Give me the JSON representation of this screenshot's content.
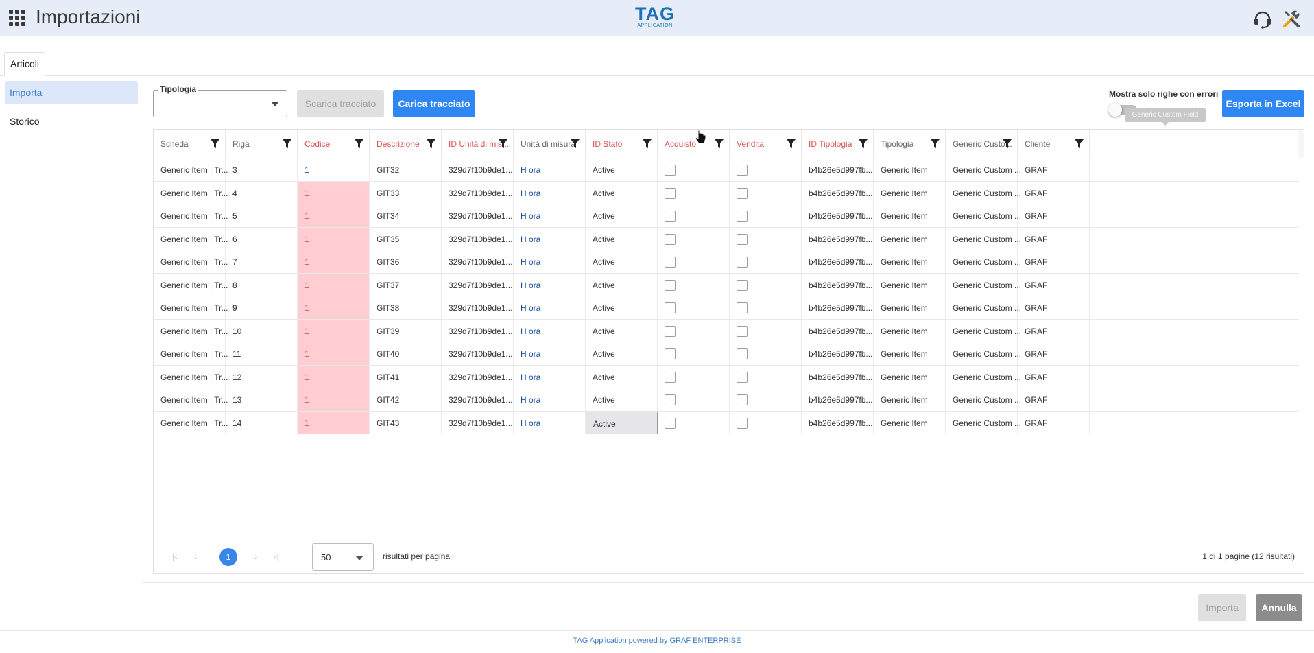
{
  "header": {
    "title": "Importazioni",
    "logo_main": "TAG",
    "logo_sub": "APPLICATION",
    "icons": [
      "apps-grid-icon",
      "headset-icon",
      "tools-icon"
    ]
  },
  "tabs": [
    {
      "label": "Articoli"
    }
  ],
  "sidebar": {
    "items": [
      {
        "label": "Importa",
        "active": true
      },
      {
        "label": "Storico",
        "active": false
      }
    ]
  },
  "toolbar": {
    "tipologia_label": "Tipologia",
    "tipologia_value": "",
    "download_label": "Scarica tracciato",
    "upload_label": "Carica tracciato",
    "errors_toggle_label": "Mostra solo righe con errori",
    "errors_toggle_on": false,
    "export_label": "Esporta in Excel",
    "tooltip": "Generic Custom Field"
  },
  "grid": {
    "columns": [
      {
        "label": "Scheda",
        "error": false
      },
      {
        "label": "Riga",
        "error": false
      },
      {
        "label": "Codice",
        "error": true
      },
      {
        "label": "Descrizione",
        "error": true
      },
      {
        "label": "ID Unità di mis...",
        "error": true
      },
      {
        "label": "Unità di misura",
        "error": false
      },
      {
        "label": "ID Stato",
        "error": true
      },
      {
        "label": "Acquisto",
        "error": true
      },
      {
        "label": "Vendita",
        "error": true
      },
      {
        "label": "ID Tipologia",
        "error": true
      },
      {
        "label": "Tipologia",
        "error": false
      },
      {
        "label": "Generic Custo...",
        "error": false
      },
      {
        "label": "Cliente",
        "error": false
      }
    ],
    "rows": [
      {
        "scheda": "Generic Item | Tr...",
        "riga": "3",
        "codice": "1",
        "codice_error": false,
        "descrizione": "GIT32",
        "id_um": "329d7f10b9de1...",
        "um": "H ora",
        "stato": "Active",
        "acquisto": false,
        "vendita": false,
        "id_tipologia": "b4b26e5d997fb...",
        "tipologia": "Generic Item",
        "custom": "Generic Custom ...",
        "cliente": "GRAF"
      },
      {
        "scheda": "Generic Item | Tr...",
        "riga": "4",
        "codice": "1",
        "codice_error": true,
        "descrizione": "GIT33",
        "id_um": "329d7f10b9de1...",
        "um": "H ora",
        "stato": "Active",
        "acquisto": false,
        "vendita": false,
        "id_tipologia": "b4b26e5d997fb...",
        "tipologia": "Generic Item",
        "custom": "Generic Custom ...",
        "cliente": "GRAF"
      },
      {
        "scheda": "Generic Item | Tr...",
        "riga": "5",
        "codice": "1",
        "codice_error": true,
        "descrizione": "GIT34",
        "id_um": "329d7f10b9de1...",
        "um": "H ora",
        "stato": "Active",
        "acquisto": false,
        "vendita": false,
        "id_tipologia": "b4b26e5d997fb...",
        "tipologia": "Generic Item",
        "custom": "Generic Custom ...",
        "cliente": "GRAF"
      },
      {
        "scheda": "Generic Item | Tr...",
        "riga": "6",
        "codice": "1",
        "codice_error": true,
        "descrizione": "GIT35",
        "id_um": "329d7f10b9de1...",
        "um": "H ora",
        "stato": "Active",
        "acquisto": false,
        "vendita": false,
        "id_tipologia": "b4b26e5d997fb...",
        "tipologia": "Generic Item",
        "custom": "Generic Custom ...",
        "cliente": "GRAF"
      },
      {
        "scheda": "Generic Item | Tr...",
        "riga": "7",
        "codice": "1",
        "codice_error": true,
        "descrizione": "GIT36",
        "id_um": "329d7f10b9de1...",
        "um": "H ora",
        "stato": "Active",
        "acquisto": false,
        "vendita": false,
        "id_tipologia": "b4b26e5d997fb...",
        "tipologia": "Generic Item",
        "custom": "Generic Custom ...",
        "cliente": "GRAF"
      },
      {
        "scheda": "Generic Item | Tr...",
        "riga": "8",
        "codice": "1",
        "codice_error": true,
        "descrizione": "GIT37",
        "id_um": "329d7f10b9de1...",
        "um": "H ora",
        "stato": "Active",
        "acquisto": false,
        "vendita": false,
        "id_tipologia": "b4b26e5d997fb...",
        "tipologia": "Generic Item",
        "custom": "Generic Custom ...",
        "cliente": "GRAF"
      },
      {
        "scheda": "Generic Item | Tr...",
        "riga": "9",
        "codice": "1",
        "codice_error": true,
        "descrizione": "GIT38",
        "id_um": "329d7f10b9de1...",
        "um": "H ora",
        "stato": "Active",
        "acquisto": false,
        "vendita": false,
        "id_tipologia": "b4b26e5d997fb...",
        "tipologia": "Generic Item",
        "custom": "Generic Custom ...",
        "cliente": "GRAF"
      },
      {
        "scheda": "Generic Item | Tr...",
        "riga": "10",
        "codice": "1",
        "codice_error": true,
        "descrizione": "GIT39",
        "id_um": "329d7f10b9de1...",
        "um": "H ora",
        "stato": "Active",
        "acquisto": false,
        "vendita": false,
        "id_tipologia": "b4b26e5d997fb...",
        "tipologia": "Generic Item",
        "custom": "Generic Custom ...",
        "cliente": "GRAF"
      },
      {
        "scheda": "Generic Item | Tr...",
        "riga": "11",
        "codice": "1",
        "codice_error": true,
        "descrizione": "GIT40",
        "id_um": "329d7f10b9de1...",
        "um": "H ora",
        "stato": "Active",
        "acquisto": false,
        "vendita": false,
        "id_tipologia": "b4b26e5d997fb...",
        "tipologia": "Generic Item",
        "custom": "Generic Custom ...",
        "cliente": "GRAF"
      },
      {
        "scheda": "Generic Item | Tr...",
        "riga": "12",
        "codice": "1",
        "codice_error": true,
        "descrizione": "GIT41",
        "id_um": "329d7f10b9de1...",
        "um": "H ora",
        "stato": "Active",
        "acquisto": false,
        "vendita": false,
        "id_tipologia": "b4b26e5d997fb...",
        "tipologia": "Generic Item",
        "custom": "Generic Custom ...",
        "cliente": "GRAF"
      },
      {
        "scheda": "Generic Item | Tr...",
        "riga": "13",
        "codice": "1",
        "codice_error": true,
        "descrizione": "GIT42",
        "id_um": "329d7f10b9de1...",
        "um": "H ora",
        "stato": "Active",
        "acquisto": false,
        "vendita": false,
        "id_tipologia": "b4b26e5d997fb...",
        "tipologia": "Generic Item",
        "custom": "Generic Custom ...",
        "cliente": "GRAF"
      },
      {
        "scheda": "Generic Item | Tr...",
        "riga": "14",
        "codice": "1",
        "codice_error": true,
        "descrizione": "GIT43",
        "id_um": "329d7f10b9de1...",
        "um": "H ora",
        "stato": "Active",
        "acquisto": false,
        "vendita": false,
        "id_tipologia": "b4b26e5d997fb...",
        "tipologia": "Generic Item",
        "custom": "Generic Custom ...",
        "cliente": "GRAF",
        "stato_selected": true
      }
    ]
  },
  "pager": {
    "current_page": "1",
    "page_size": "50",
    "page_size_label": "risultati per pagina",
    "summary": "1 di 1 pagine (12 risultati)"
  },
  "actions": {
    "import_label": "Importa",
    "cancel_label": "Annulla"
  },
  "footer": {
    "text": "TAG Application powered by GRAF ENTERPRISE"
  },
  "colors": {
    "primary": "#2f86f5",
    "error_text": "#d9534f",
    "error_cell": "#ffcdd2",
    "header_bg": "#e6edf8",
    "logo": "#1a73b8"
  }
}
